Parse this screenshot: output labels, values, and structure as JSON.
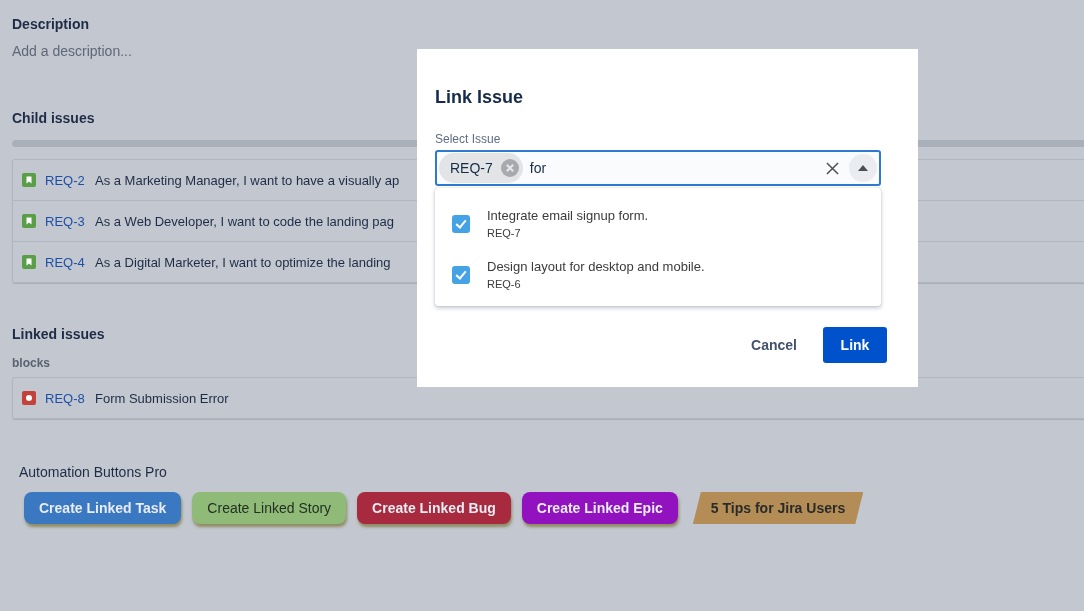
{
  "description": {
    "heading": "Description",
    "placeholder": "Add a description..."
  },
  "child_issues": {
    "heading": "Child issues",
    "rows": [
      {
        "kind": "story",
        "key": "REQ-2",
        "summary": "As a Marketing Manager, I want to have a visually ap"
      },
      {
        "kind": "story",
        "key": "REQ-3",
        "summary": "As a Web Developer, I want to code the landing pag"
      },
      {
        "kind": "story",
        "key": "REQ-4",
        "summary": "As a Digital Marketer, I want to optimize the landing"
      }
    ]
  },
  "linked_issues": {
    "heading": "Linked issues",
    "relation": "blocks",
    "rows": [
      {
        "kind": "bug",
        "key": "REQ-8",
        "summary": "Form Submission Error"
      }
    ]
  },
  "automation": {
    "heading": "Automation Buttons Pro",
    "buttons": [
      {
        "kind": "button",
        "label": "Create Linked Task",
        "color": "#3a78c2"
      },
      {
        "kind": "button",
        "label": "Create Linked Story",
        "color": "#8fba78"
      },
      {
        "kind": "button",
        "label": "Create Linked Bug",
        "color": "#a82a3e"
      },
      {
        "kind": "button",
        "label": "Create Linked Epic",
        "color": "#9212c0"
      },
      {
        "kind": "tip",
        "label": "5 Tips for Jira Users",
        "color": "#b38d55"
      }
    ]
  },
  "dialog": {
    "title": "Link Issue",
    "field_label": "Select Issue",
    "chips": [
      "REQ-7"
    ],
    "value": "for",
    "options": [
      {
        "title": "Integrate email signup form.",
        "key": "REQ-7",
        "checked": true
      },
      {
        "title": "Design layout for desktop and mobile.",
        "key": "REQ-6",
        "checked": true
      }
    ],
    "buttons": [
      {
        "kind": "subtle",
        "label": "Cancel"
      },
      {
        "kind": "primary",
        "label": "Link"
      }
    ]
  }
}
